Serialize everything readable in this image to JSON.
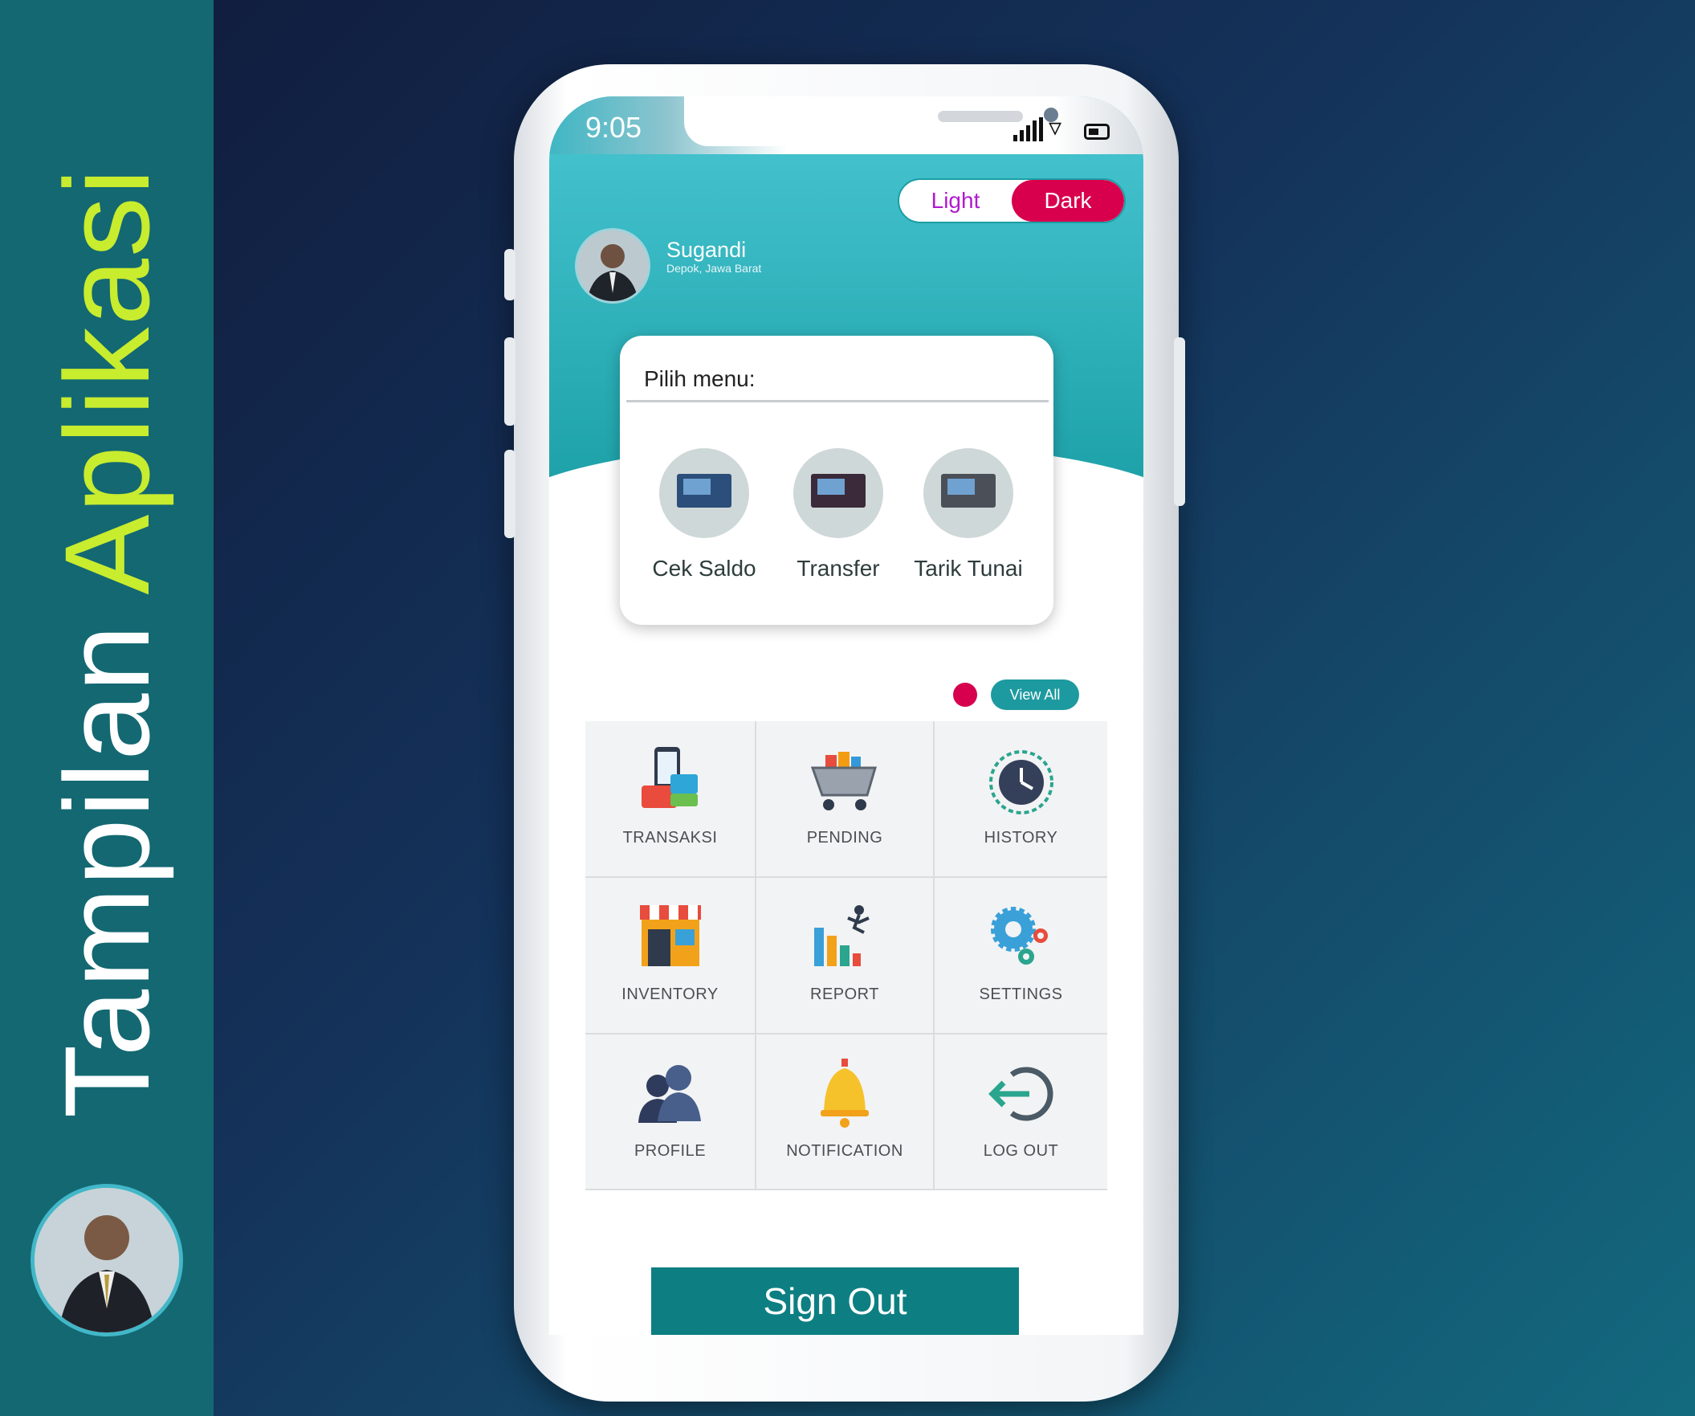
{
  "banner": {
    "title_main": "Tampilan",
    "title_highlight": "Aplikasi"
  },
  "status": {
    "time": "9:05"
  },
  "theme_toggle": {
    "light": "Light",
    "dark": "Dark",
    "active": "Dark",
    "active_color": "#d8004d"
  },
  "user": {
    "name": "Sugandi",
    "location": "Depok, Jawa Barat"
  },
  "menu_card": {
    "title": "Pilih menu:",
    "items": [
      {
        "label": "Cek Saldo",
        "icon": "atm-balance-icon"
      },
      {
        "label": "Transfer",
        "icon": "atm-transfer-icon"
      },
      {
        "label": "Tarik Tunai",
        "icon": "atm-withdraw-icon"
      }
    ]
  },
  "view_all": {
    "label": "View All"
  },
  "grid": [
    {
      "label": "TRANSAKSI",
      "icon": "transaction-icon"
    },
    {
      "label": "PENDING",
      "icon": "cart-icon"
    },
    {
      "label": "HISTORY",
      "icon": "clock-history-icon"
    },
    {
      "label": "INVENTORY",
      "icon": "store-icon"
    },
    {
      "label": "REPORT",
      "icon": "report-chart-icon"
    },
    {
      "label": "SETTINGS",
      "icon": "gears-icon"
    },
    {
      "label": "PROFILE",
      "icon": "users-icon"
    },
    {
      "label": "NOTIFICATION",
      "icon": "bell-icon"
    },
    {
      "label": "LOG OUT",
      "icon": "logout-icon"
    }
  ],
  "sign_out": {
    "label": "Sign Out"
  },
  "colors": {
    "accent": "#1d9aa0",
    "banner_bg": "#136872",
    "highlight": "#c8ec2e",
    "sign_out_bg": "#0d7f82"
  }
}
